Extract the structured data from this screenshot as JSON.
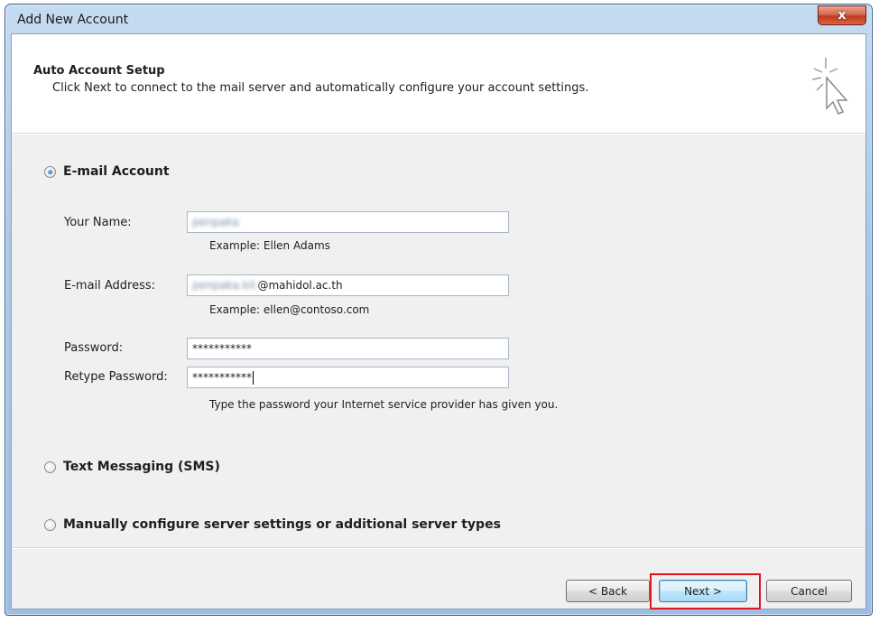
{
  "window": {
    "title": "Add New Account",
    "close_glyph": "x"
  },
  "header": {
    "title": "Auto Account Setup",
    "subtitle": "Click Next to connect to the mail server and automatically configure your account settings.",
    "icon": "cursor-sparkle-icon"
  },
  "email_account": {
    "label": "E-mail Account",
    "selected": true,
    "your_name": {
      "label": "Your Name:",
      "value_obscured": "penpaka",
      "example": "Example: Ellen Adams"
    },
    "email": {
      "label": "E-mail Address:",
      "value_obscured": "penpaka.kit",
      "value_visible": "@mahidol.ac.th",
      "example": "Example: ellen@contoso.com"
    },
    "password": {
      "label": "Password:",
      "value": "***********"
    },
    "retype_password": {
      "label": "Retype Password:",
      "value": "***********"
    },
    "password_hint": "Type the password your Internet service provider has given you."
  },
  "sms": {
    "label": "Text Messaging (SMS)",
    "selected": false
  },
  "manual": {
    "label": "Manually configure server settings or additional server types",
    "selected": false
  },
  "buttons": {
    "back": "< Back",
    "next": "Next >",
    "cancel": "Cancel"
  },
  "colors": {
    "highlight": "#e0141e",
    "title_bar": "#a9c7e8",
    "close_button": "#c0391c"
  }
}
